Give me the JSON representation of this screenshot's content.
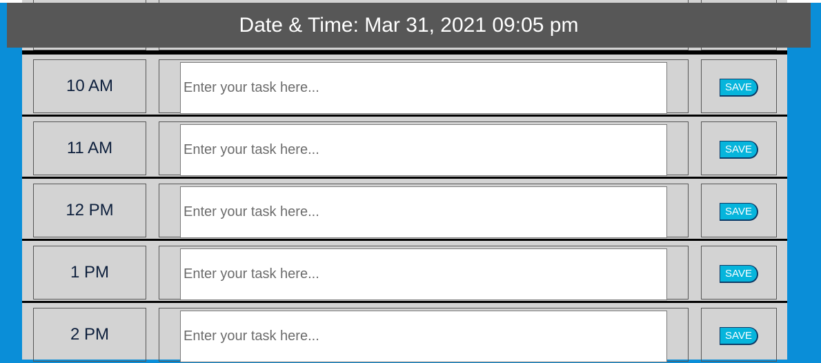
{
  "header": {
    "title": "Date & Time: Mar 31, 2021 09:05 pm"
  },
  "colors": {
    "background": "#0a8ed8",
    "header_bg": "#575757",
    "row_bg": "#d3d3d3",
    "save_button": "#06b5dc",
    "hour_text": "#0d1f3c"
  },
  "task_placeholder": "Enter your task here...",
  "save_label": "SAVE",
  "rows": [
    {
      "hour": "10 AM",
      "task_value": ""
    },
    {
      "hour": "11 AM",
      "task_value": ""
    },
    {
      "hour": "12 PM",
      "task_value": ""
    },
    {
      "hour": "1 PM",
      "task_value": ""
    },
    {
      "hour": "2 PM",
      "task_value": ""
    }
  ]
}
